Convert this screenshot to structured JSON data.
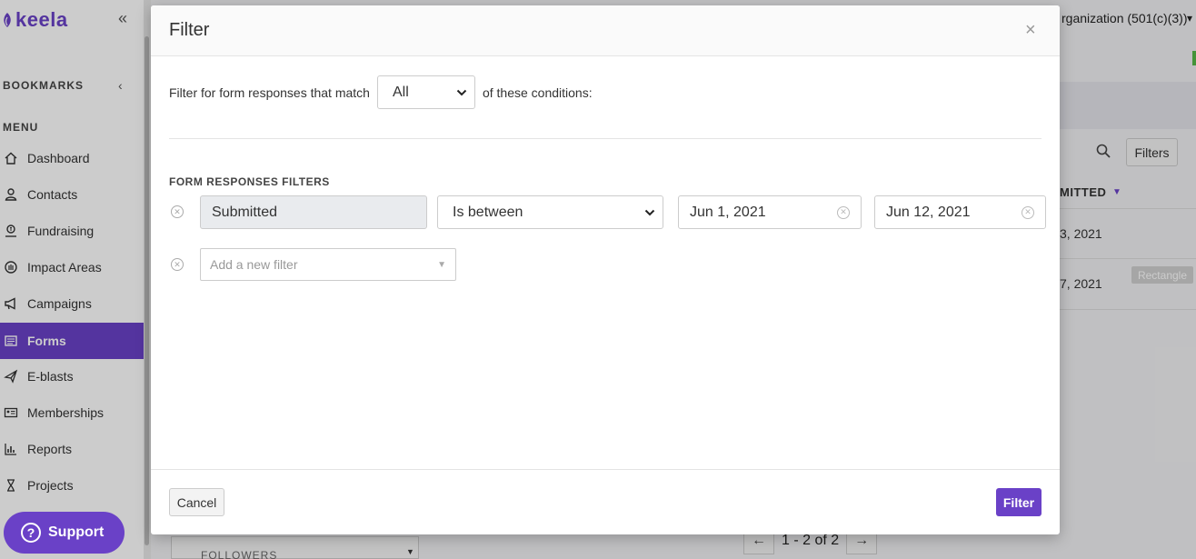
{
  "app": {
    "logo_text": "keela",
    "brand_color": "#6a41c7",
    "success_color": "#57b847"
  },
  "sidebar": {
    "collapse_icon": "double-chevron-left-icon",
    "bookmarks_label": "BOOKMARKS",
    "menu_label": "MENU",
    "items": [
      {
        "label": "Dashboard",
        "icon": "home-icon",
        "active": false
      },
      {
        "label": "Contacts",
        "icon": "person-icon",
        "active": false
      },
      {
        "label": "Fundraising",
        "icon": "donation-icon",
        "active": false
      },
      {
        "label": "Impact Areas",
        "icon": "hand-icon",
        "active": false
      },
      {
        "label": "Campaigns",
        "icon": "megaphone-icon",
        "active": false
      },
      {
        "label": "Forms",
        "icon": "form-icon",
        "active": true
      },
      {
        "label": "E-blasts",
        "icon": "paper-plane-icon",
        "active": false
      },
      {
        "label": "Memberships",
        "icon": "id-card-icon",
        "active": false
      },
      {
        "label": "Reports",
        "icon": "bar-chart-icon",
        "active": false
      },
      {
        "label": "Projects",
        "icon": "hourglass-icon",
        "active": false
      }
    ],
    "support_label": "Support"
  },
  "background": {
    "org_name": "rganization (501(c)(3))",
    "filters_button": "Filters",
    "column_header": "MITTED",
    "rows": [
      {
        "date": "3, 2021"
      },
      {
        "date": "7, 2021"
      }
    ],
    "rectangle_tag": "Rectangle",
    "pagination": {
      "text": "1 - 2 of 2"
    },
    "followers_label": "FOLLOWERS"
  },
  "modal": {
    "title": "Filter",
    "close_label": "×",
    "match_prefix": "Filter for form responses that match",
    "match_value": "All",
    "match_suffix": "of these conditions:",
    "section_label": "FORM RESPONSES FILTERS",
    "filters": [
      {
        "field": "Submitted",
        "operator": "Is between",
        "value_start": "Jun 1, 2021",
        "value_end": "Jun 12, 2021"
      }
    ],
    "add_filter_placeholder": "Add a new filter",
    "cancel_label": "Cancel",
    "submit_label": "Filter"
  }
}
